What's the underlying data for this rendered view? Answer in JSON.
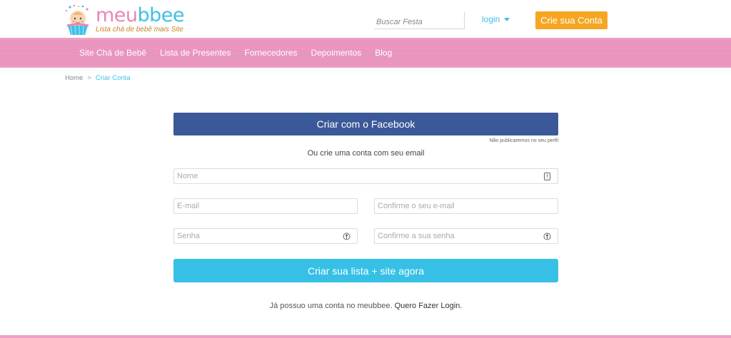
{
  "brand": {
    "name_part1": "meu",
    "name_part2": "bbee",
    "tagline": "Lista chá de bebê mais Site",
    "colors": {
      "pink": "#e888b4",
      "blue": "#3ec0e8",
      "orange": "#f5a623"
    }
  },
  "header": {
    "search_placeholder": "Buscar Festa",
    "login_label": "login",
    "signup_label": "Crie sua Conta"
  },
  "nav": {
    "items": [
      {
        "label": "Site Chá de Bebê"
      },
      {
        "label": "Lista de Presentes"
      },
      {
        "label": "Fornecedores"
      },
      {
        "label": "Depoimentos"
      },
      {
        "label": "Blog"
      }
    ]
  },
  "breadcrumb": {
    "home": "Home",
    "separator": ">",
    "current": "Criar Conta"
  },
  "form": {
    "facebook_button": "Criar com o Facebook",
    "facebook_note": "Não publicaremos no seu perfil",
    "or_text": "Ou crie uma conta com seu email",
    "fields": {
      "name_placeholder": "Nome",
      "email_placeholder": "E-mail",
      "email_confirm_placeholder": "Confirme o seu e-mail",
      "password_placeholder": "Senha",
      "password_confirm_placeholder": "Confirme a sua senha"
    },
    "submit_button": "Criar sua lista + site agora",
    "already_text": "Já possuo uma conta no meubbee.",
    "login_link": "Quero Fazer Login."
  }
}
